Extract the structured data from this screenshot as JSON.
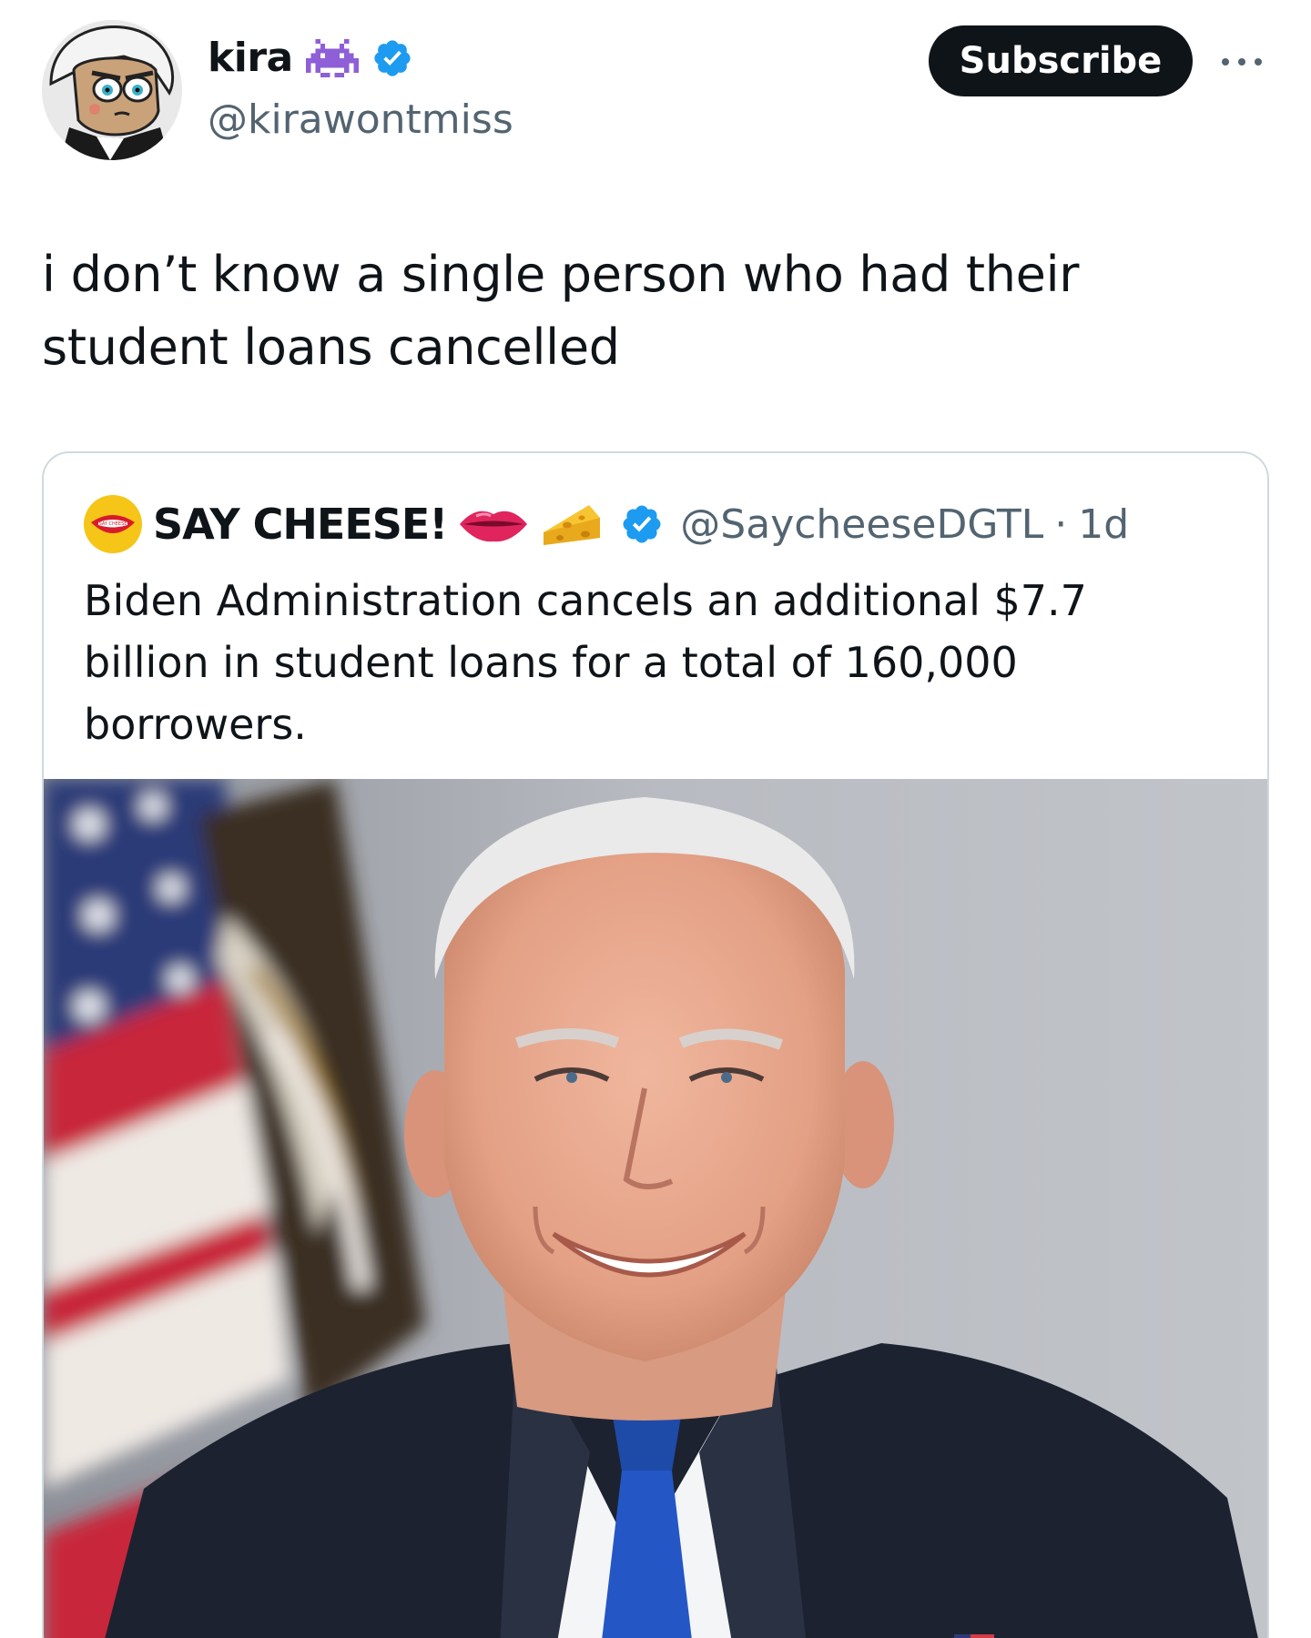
{
  "author": {
    "display_name": "kira",
    "handle": "@kirawontmiss",
    "name_emoji": "space-invader-icon",
    "verified": true
  },
  "actions": {
    "subscribe_label": "Subscribe",
    "more_icon": "more-dots-icon"
  },
  "tweet": {
    "text": "i don’t know a single person who had their student loans cancelled"
  },
  "quoted_tweet": {
    "display_name": "SAY CHEESE!",
    "name_emojis": [
      "lips-icon",
      "cheese-icon"
    ],
    "verified": true,
    "handle": "@SaycheeseDGTL",
    "separator": "·",
    "time": "1d",
    "text": "Biden Administration cancels an additional $7.7 billion in student loans for a total of 160,000 borrowers.",
    "media": "photo-portrait"
  },
  "colors": {
    "verified_blue": "#1d9bf0",
    "secondary_text": "#536471",
    "primary_text": "#0f1419",
    "button_black": "#0f1419",
    "card_border": "#cfd9de"
  }
}
